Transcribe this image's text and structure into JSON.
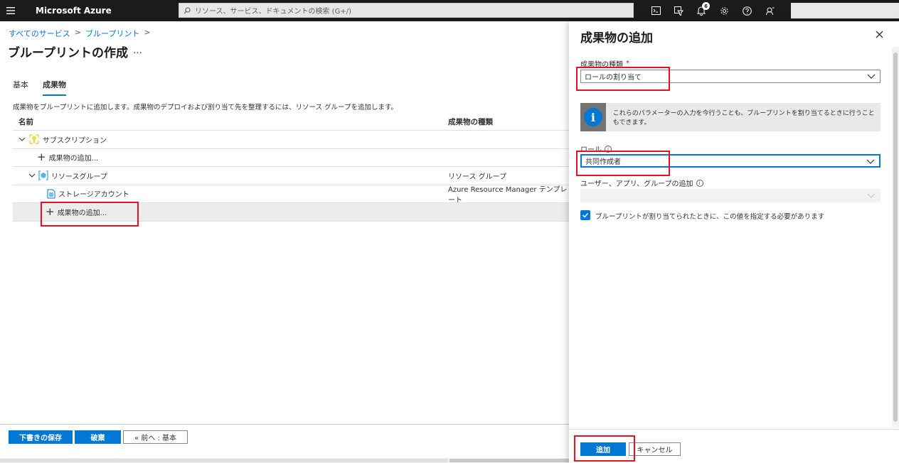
{
  "topbar": {
    "brand": "Microsoft Azure",
    "search_placeholder": "リソース、サービス、ドキュメントの検索 (G+/)",
    "notification_count": "6"
  },
  "breadcrumb": [
    "すべてのサービス",
    "ブループリント"
  ],
  "page": {
    "title": "ブループリントの作成",
    "more": "…"
  },
  "tabs": [
    {
      "label": "基本",
      "active": false
    },
    {
      "label": "成果物",
      "active": true
    }
  ],
  "description": "成果物をブループリントに追加します。成果物のデプロイおよび割り当て先を整理するには、リソース グループを追加します。",
  "table": {
    "headers": {
      "name": "名前",
      "type": "成果物の種類"
    },
    "rows": [
      {
        "name": "サブスクリプション",
        "type": ""
      },
      {
        "name": "成果物の追加...",
        "type": ""
      },
      {
        "name": "リソースグループ",
        "type": "リソース グループ"
      },
      {
        "name": "ストレージアカウント",
        "type": "Azure Resource Manager テンプレート"
      },
      {
        "name": "成果物の追加...",
        "type": ""
      }
    ]
  },
  "footer": {
    "save_draft": "下書きの保存",
    "discard": "破棄",
    "previous": "« 前へ : 基本"
  },
  "panel": {
    "title": "成果物の追加",
    "artifact_type_label": "成果物の種類",
    "required_mark": "*",
    "artifact_type_value": "ロールの割り当て",
    "info_text": "これらのパラメーターの入力を今行うことも、ブループリントを割り当てるときに行うこともできます。",
    "role_label": "ロール",
    "role_value": "共同作成者",
    "users_label": "ユーザー、アプリ、グループの追加",
    "users_value": "",
    "checkbox_label": "ブループリントが割り当てられたときに、この値を指定する必要があります",
    "checkbox_checked": true,
    "add_button": "追加",
    "cancel_button": "キャンセル"
  },
  "colors": {
    "accent": "#0078d4",
    "topbar": "#1b1b1b",
    "highlight": "#e81123"
  }
}
